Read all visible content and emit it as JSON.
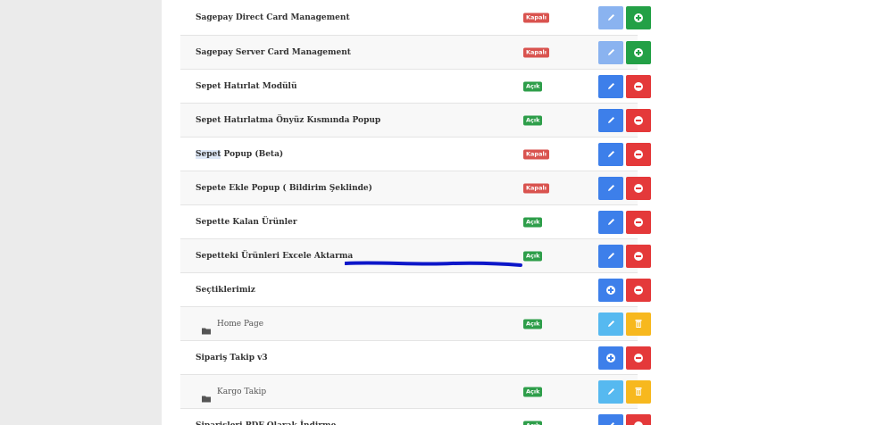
{
  "modules": [
    {
      "name": "Sagepay Direct Card Management",
      "status": "Kapalı",
      "state": "kapali",
      "edit": "lightblue",
      "action": "add",
      "child": false
    },
    {
      "name": "Sagepay Server Card Management",
      "status": "Kapalı",
      "state": "kapali",
      "edit": "lightblue",
      "action": "add",
      "child": false
    },
    {
      "name": "Sepet Hatırlat Modülü",
      "status": "Açık",
      "state": "acik",
      "edit": "blue",
      "action": "remove",
      "child": false
    },
    {
      "name": "Sepet Hatırlatma Önyüz Kısmında Popup",
      "status": "Açık",
      "state": "acik",
      "edit": "blue",
      "action": "remove",
      "child": false
    },
    {
      "name": "Popup (Beta)",
      "name_highlight": "Sepet",
      "status": "Kapalı",
      "state": "kapali",
      "edit": "blue",
      "action": "remove",
      "child": false
    },
    {
      "name": "Sepete Ekle Popup ( Bildirim Şeklinde)",
      "status": "Kapalı",
      "state": "kapali",
      "edit": "blue",
      "action": "remove",
      "child": false
    },
    {
      "name": "Sepette Kalan Ürünler",
      "status": "Açık",
      "state": "acik",
      "edit": "blue",
      "action": "remove",
      "child": false
    },
    {
      "name": "Sepetteki Ürünleri Excele Aktarma",
      "status": "Açık",
      "state": "acik",
      "edit": "blue",
      "action": "remove",
      "child": false
    },
    {
      "name": "Seçtiklerimiz",
      "status": "",
      "state": "",
      "edit": "blue-add",
      "action": "remove",
      "child": false
    },
    {
      "name": "Home Page",
      "status": "Açık",
      "state": "acik",
      "edit": "cyan",
      "action": "delete",
      "child": true
    },
    {
      "name": "Sipariş Takip v3",
      "status": "",
      "state": "",
      "edit": "blue-add",
      "action": "remove",
      "child": false
    },
    {
      "name": "Kargo Takip",
      "status": "Açık",
      "state": "acik",
      "edit": "cyan",
      "action": "delete",
      "child": true
    },
    {
      "name": "Siparişleri PDF Olarak İndirme",
      "status": "Açık",
      "state": "acik",
      "edit": "blue",
      "action": "remove",
      "child": false
    }
  ],
  "colors": {
    "kapali": "#d9534f",
    "acik": "#2e9e4a",
    "annotation": "#0d17c9"
  }
}
